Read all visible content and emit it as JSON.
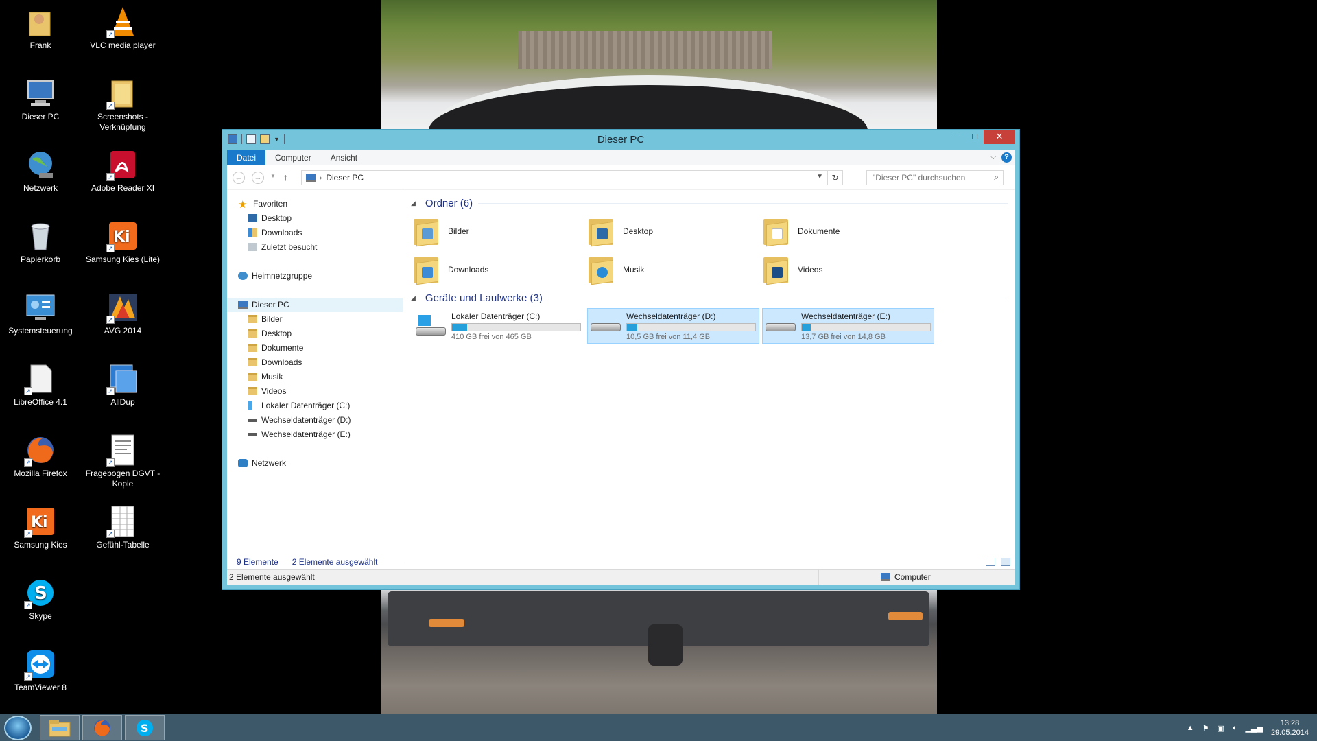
{
  "desktop": {
    "icons": [
      {
        "label": "Frank",
        "icon": "user-folder-icon"
      },
      {
        "label": "VLC media player",
        "icon": "vlc-icon"
      },
      {
        "label": "Dieser PC",
        "icon": "computer-icon"
      },
      {
        "label": "Screenshots - Verknüpfung",
        "icon": "folder-shortcut-icon"
      },
      {
        "label": "Netzwerk",
        "icon": "network-globe-icon"
      },
      {
        "label": "Adobe Reader XI",
        "icon": "adobe-reader-icon"
      },
      {
        "label": "Papierkorb",
        "icon": "recycle-bin-icon"
      },
      {
        "label": "Samsung Kies (Lite)",
        "icon": "samsung-kies-lite-icon"
      },
      {
        "label": "Systemsteuerung",
        "icon": "control-panel-icon"
      },
      {
        "label": "AVG 2014",
        "icon": "avg-icon"
      },
      {
        "label": "LibreOffice 4.1",
        "icon": "libreoffice-icon"
      },
      {
        "label": "AllDup",
        "icon": "alldup-icon"
      },
      {
        "label": "Mozilla Firefox",
        "icon": "firefox-icon"
      },
      {
        "label": "Fragebogen DGVT - Kopie",
        "icon": "document-icon"
      },
      {
        "label": "Samsung Kies",
        "icon": "samsung-kies-icon"
      },
      {
        "label": "Gefühl-Tabelle",
        "icon": "spreadsheet-icon"
      },
      {
        "label": "Skype",
        "icon": "skype-icon"
      },
      {
        "label": "TeamViewer 8",
        "icon": "teamviewer-icon"
      }
    ]
  },
  "window": {
    "title": "Dieser PC",
    "controls": {
      "minimize": "–",
      "maximize": "□",
      "close": "✕"
    },
    "ribbon_tabs": [
      "Datei",
      "Computer",
      "Ansicht"
    ],
    "help": "?",
    "address": {
      "crumb": "Dieser PC"
    },
    "search": {
      "placeholder": "\"Dieser PC\" durchsuchen"
    },
    "nav_pane": {
      "favorites": {
        "header": "Favoriten",
        "items": [
          "Desktop",
          "Downloads",
          "Zuletzt besucht"
        ]
      },
      "homegroup": "Heimnetzgruppe",
      "this_pc": {
        "header": "Dieser PC",
        "items": [
          "Bilder",
          "Desktop",
          "Dokumente",
          "Downloads",
          "Musik",
          "Videos",
          "Lokaler Datenträger (C:)",
          "Wechseldatenträger (D:)",
          "Wechseldatenträger (E:)"
        ]
      },
      "network": "Netzwerk"
    },
    "content": {
      "folders_header": "Ordner (6)",
      "folders": [
        "Bilder",
        "Desktop",
        "Dokumente",
        "Downloads",
        "Musik",
        "Videos"
      ],
      "drives_header": "Geräte und Laufwerke (3)",
      "drives": [
        {
          "name": "Lokaler Datenträger (C:)",
          "free": "410 GB frei von 465 GB",
          "used_fraction": 0.12,
          "selected": false
        },
        {
          "name": "Wechseldatenträger (D:)",
          "free": "10,5 GB frei von 11,4 GB",
          "used_fraction": 0.08,
          "selected": true
        },
        {
          "name": "Wechseldatenträger (E:)",
          "free": "13,7 GB frei von 14,8 GB",
          "used_fraction": 0.07,
          "selected": true
        }
      ]
    },
    "status": {
      "count": "9 Elemente",
      "selected": "2 Elemente ausgewählt"
    },
    "details_bar": {
      "text": "2 Elemente ausgewählt",
      "zone": "Computer"
    }
  },
  "taskbar": {
    "apps": [
      "file-explorer-icon",
      "firefox-icon",
      "skype-icon"
    ],
    "clock": {
      "time": "13:28",
      "date": "29.05.2014"
    }
  },
  "colors": {
    "accent": "#1979ca",
    "window_frame": "#74c5dc",
    "selection": "#cce8ff",
    "close": "#c7413a"
  }
}
